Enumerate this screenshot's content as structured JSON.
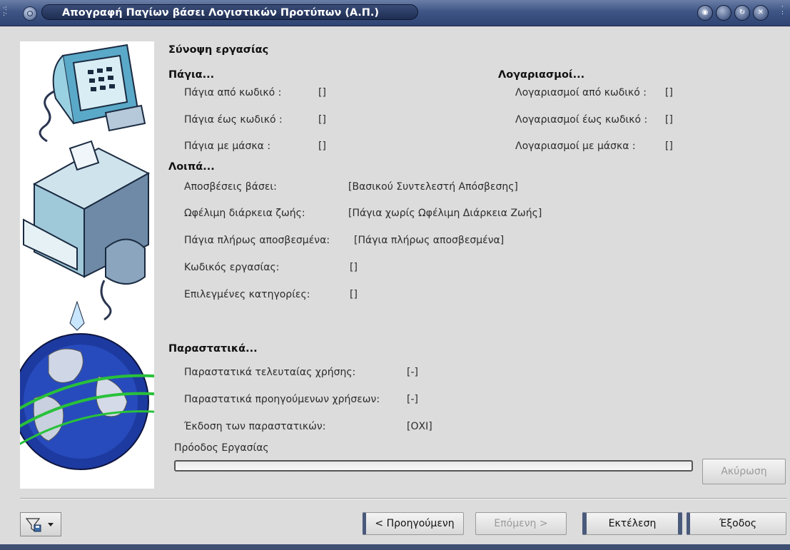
{
  "window": {
    "title": "Απογραφή Παγίων βάσει Λογιστικών Προτύπων (Α.Π.)",
    "title_buttons": [
      "help",
      "minimize",
      "restore",
      "close"
    ]
  },
  "summary": {
    "heading": "Σύνοψη εργασίας",
    "assets": {
      "heading": "Πάγια...",
      "from_label": "Πάγια από κωδικό :",
      "from_value": "[]",
      "to_label": "Πάγια έως κωδικό :",
      "to_value": "[]",
      "mask_label": "Πάγια με μάσκα :",
      "mask_value": "[]"
    },
    "accounts": {
      "heading": "Λογαριασμοί...",
      "from_label": "Λογαριασμοί από κωδικό :",
      "from_value": "[]",
      "to_label": "Λογαριασμοί έως κωδικό :",
      "to_value": "[]",
      "mask_label": "Λογαριασμοί με μάσκα :",
      "mask_value": "[]"
    },
    "other": {
      "heading": "Λοιπά...",
      "depreciation_label": "Αποσβέσεις βάσει:",
      "depreciation_value": "[Βασικού Συντελεστή Απόσβεσης]",
      "lifetime_label": "Ωφέλιμη διάρκεια ζωής:",
      "lifetime_value": "[Πάγια χωρίς Ωφέλιμη Διάρκεια Ζωής]",
      "fully_label": "Πάγια πλήρως αποσβεσμένα:",
      "fully_value": "[Πάγια πλήρως αποσβεσμένα]",
      "jobcode_label": "Κωδικός εργασίας:",
      "jobcode_value": "[]",
      "categories_label": "Επιλεγμένες κατηγορίες:",
      "categories_value": "[]"
    },
    "documents": {
      "heading": "Παραστατικά...",
      "last_year_label": "Παραστατικά τελευταίας χρήσης:",
      "last_year_value": "[-]",
      "prev_years_label": "Παραστατικά προηγούμενων χρήσεων:",
      "prev_years_value": "[-]",
      "issue_label": "Έκδοση των παραστατικών:",
      "issue_value": "[ΟΧΙ]"
    }
  },
  "progress": {
    "label": "Πρόοδος Εργασίας",
    "percent": 0
  },
  "buttons": {
    "cancel": "Ακύρωση",
    "previous": "< Προηγούμενη",
    "next": "Επόμενη >",
    "execute": "Εκτέλεση",
    "exit": "Έξοδος"
  },
  "icons": {
    "filter": "filter-icon",
    "dropdown": "chevron-down-icon"
  },
  "colors": {
    "titlebar": "#3e5585",
    "accent_border": "#4a5a7c"
  }
}
